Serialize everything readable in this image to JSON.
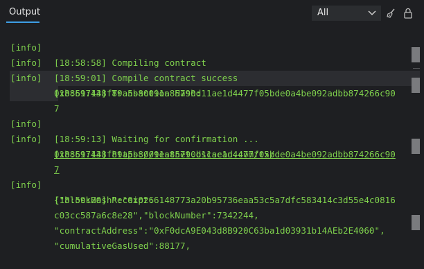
{
  "header": {
    "tab_output": "Output",
    "filter_value": "All",
    "icons": {
      "dropdown": "chevron-down-icon",
      "clear": "broom-icon",
      "lock": "lock-icon"
    }
  },
  "log": {
    "rows": [
      {
        "tag": "[info]",
        "msg": "[18:58:58] Compiling contract"
      },
      {
        "tag": "[info]",
        "msg": "[18:59:01] Compile contract success"
      },
      {
        "tag": "[info]",
        "msg": "[18:59:13] Transaction Hash:"
      },
      {
        "tag": "",
        "msg": "0xb8617448f89a5b80091a85790d11ae1d4477f05bde0a4be092adbb874266c90"
      },
      {
        "tag": "",
        "msg": "7"
      },
      {
        "tag": "[info]",
        "msg": "[18:59:13] Waiting for confirmation ..."
      },
      {
        "tag": "[info]",
        "msg_prefix": "[18:59:13] ",
        "link": "https://testnet.bscscan.com/tx/"
      },
      {
        "tag": "",
        "link": "0xb8617448f89a5b80091a85790d11ae1d4477f05bde0a4be092adbb874266c90"
      },
      {
        "tag": "",
        "link": "7"
      },
      {
        "tag": "[info]",
        "msg": "[18:59:20] Receipt:"
      },
      {
        "tag": "",
        "msg": "{\"blockHash\":\"0x0266148773a20b95736eaa53c5a7dfc583414c3d55e4c0816"
      },
      {
        "tag": "",
        "msg": "c03cc587a6c8e28\",\"blockNumber\":7342244,"
      },
      {
        "tag": "",
        "msg": "\"contractAddress\":\"0xF0dcA9E043d8B920C63ba1d03931b14AEb2E4060\","
      },
      {
        "tag": "",
        "msg": "\"cumulativeGasUsed\":88177,"
      }
    ]
  },
  "colors": {
    "background": "#1e1f22",
    "log_text": "#7fd14d",
    "accent": "#3d9ee6",
    "scroll_thumb": "#7a7b7e"
  }
}
